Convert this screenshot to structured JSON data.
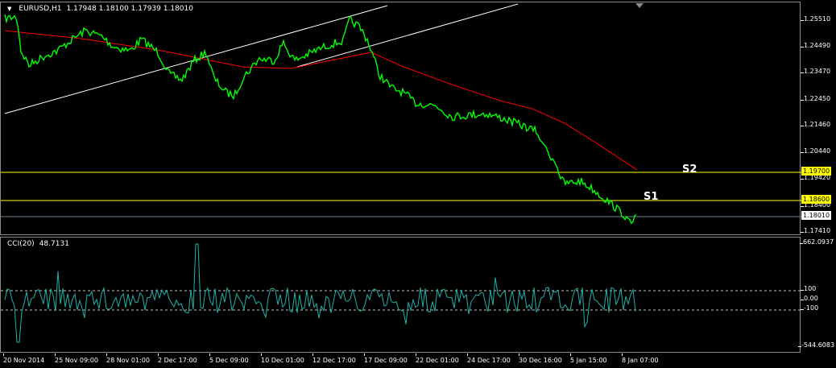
{
  "chart": {
    "symbol_line": "EURUSD,H1",
    "ohlc": "1.17948 1.18100 1.17939 1.18010",
    "cci_label": "CCI(20)",
    "cci_value": "48.7131"
  },
  "colors": {
    "price": "#00ff00",
    "ma": "#ff0000",
    "levels": "#ffff00",
    "trend": "#ffffff",
    "cci": "#20b2aa",
    "border": "#8c8c8c"
  },
  "levels": [
    {
      "label": "S2",
      "price": "1.19700"
    },
    {
      "label": "S1",
      "price": "1.18600"
    },
    {
      "label": "bid",
      "price": "1.18010"
    }
  ],
  "price_axis": [
    "1.25510",
    "1.24490",
    "1.23470",
    "1.22450",
    "1.21460",
    "1.20440",
    "1.19420",
    "1.18400",
    "1.17410"
  ],
  "cci_axis": [
    "662.0937",
    "100",
    "0.00",
    "-100",
    "-544.6083"
  ],
  "time_axis": [
    "20 Nov 2014",
    "25 Nov 09:00",
    "28 Nov 01:00",
    "2 Dec 17:00",
    "5 Dec 09:00",
    "10 Dec 01:00",
    "12 Dec 17:00",
    "17 Dec 09:00",
    "22 Dec 01:00",
    "24 Dec 17:00",
    "30 Dec 16:00",
    "5 Jan 15:00",
    "8 Jan 07:00"
  ]
}
